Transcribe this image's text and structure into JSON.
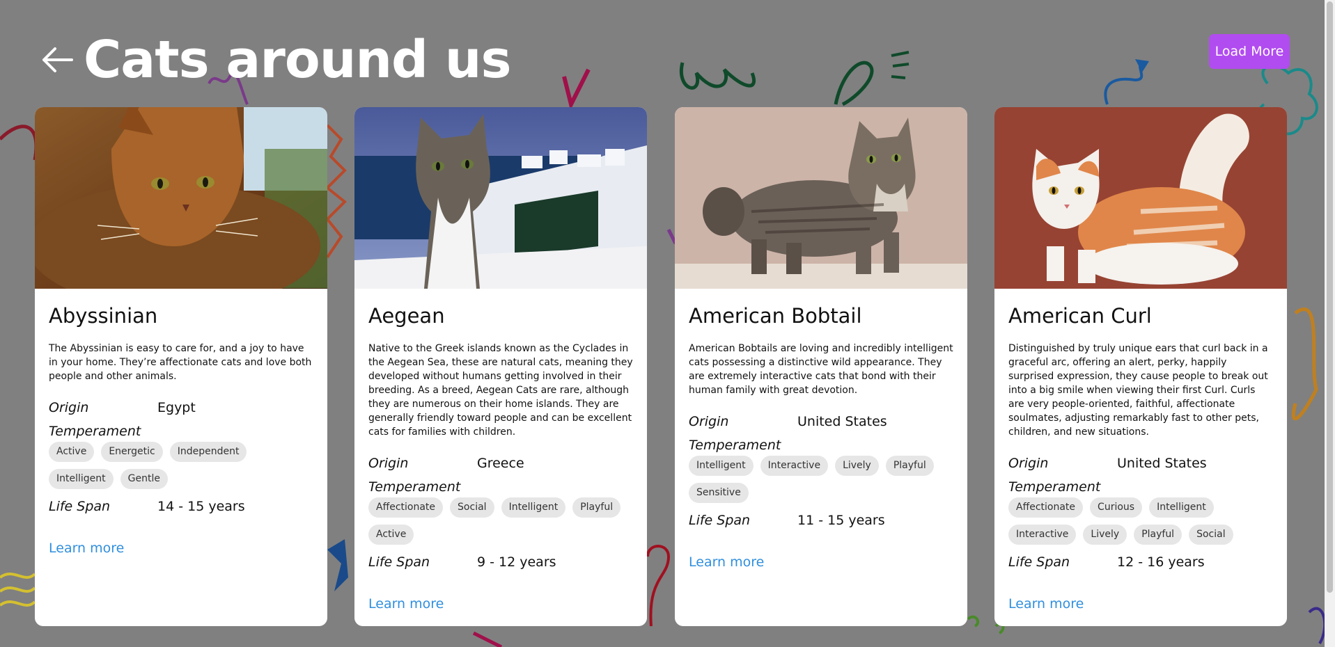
{
  "header": {
    "title": "Cats around us",
    "back_icon": "arrow-left-icon",
    "load_more_label": "Load More"
  },
  "colors": {
    "background": "#808080",
    "accent": "#b14cf0",
    "link": "#2f8fde",
    "tag_bg": "#e6e6e6"
  },
  "labels": {
    "origin": "Origin",
    "temperament": "Temperament",
    "life_span": "Life Span",
    "learn_more": "Learn more"
  },
  "cards": [
    {
      "name": "Abyssinian",
      "description": "The Abyssinian is easy to care for, and a joy to have in your home. They’re affectionate cats and love both people and other animals.",
      "origin": "Egypt",
      "temperament": [
        "Active",
        "Energetic",
        "Independent",
        "Intelligent",
        "Gentle"
      ],
      "life_span": "14 - 15 years"
    },
    {
      "name": "Aegean",
      "description": "Native to the Greek islands known as the Cyclades in the Aegean Sea, these are natural cats, meaning they developed without humans getting involved in their breeding. As a breed, Aegean Cats are rare, although they are numerous on their home islands. They are generally friendly toward people and can be excellent cats for families with children.",
      "origin": "Greece",
      "temperament": [
        "Affectionate",
        "Social",
        "Intelligent",
        "Playful",
        "Active"
      ],
      "life_span": "9 - 12 years"
    },
    {
      "name": "American Bobtail",
      "description": "American Bobtails are loving and incredibly intelligent cats possessing a distinctive wild appearance. They are extremely interactive cats that bond with their human family with great devotion.",
      "origin": "United States",
      "temperament": [
        "Intelligent",
        "Interactive",
        "Lively",
        "Playful",
        "Sensitive"
      ],
      "life_span": "11 - 15 years"
    },
    {
      "name": "American Curl",
      "description": "Distinguished by truly unique ears that curl back in a graceful arc, offering an alert, perky, happily surprised expression, they cause people to break out into a big smile when viewing their first Curl. Curls are very people-oriented, faithful, affectionate soulmates, adjusting remarkably fast to other pets, children, and new situations.",
      "origin": "United States",
      "temperament": [
        "Affectionate",
        "Curious",
        "Intelligent",
        "Interactive",
        "Lively",
        "Playful",
        "Social"
      ],
      "life_span": "12 - 16 years"
    }
  ]
}
